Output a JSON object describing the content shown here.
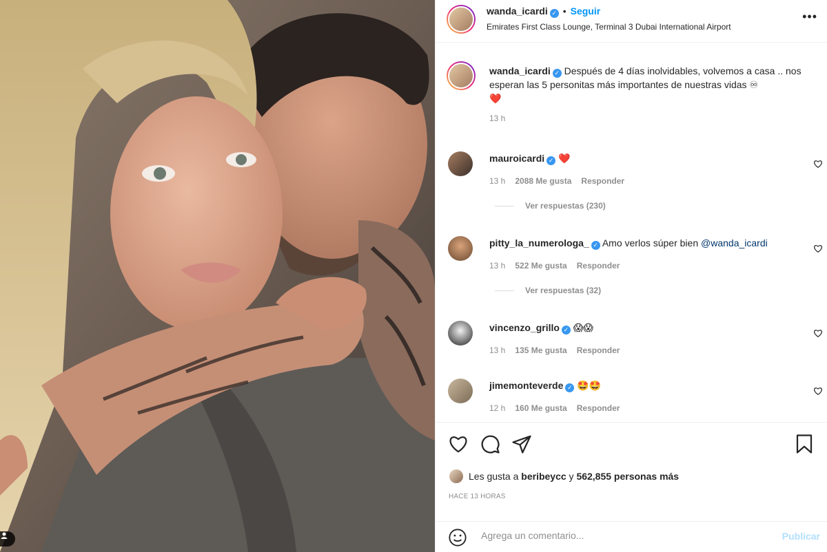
{
  "post": {
    "author": "wanda_icardi",
    "follow_label": "Seguir",
    "location": "Emirates First Class Lounge, Terminal 3 Dubai International Airport",
    "more_icon": "more-horizontal-icon",
    "caption": "Después de 4 días inolvidables, volvemos a casa .. nos esperan las 5 personitas más importantes de nuestras vidas ♾",
    "caption_emoji": "❤️",
    "caption_time": "13 h"
  },
  "comments": [
    {
      "user": "mauroicardi",
      "text": "",
      "emoji": "❤️",
      "time": "13 h",
      "likes": "2088 Me gusta",
      "reply": "Responder",
      "view_replies": "Ver respuestas (230)"
    },
    {
      "user": "pitty_la_numerologa_",
      "text": "Amo verlos súper bien",
      "mention": "@wanda_icardi",
      "time": "13 h",
      "likes": "522 Me gusta",
      "reply": "Responder",
      "view_replies": "Ver respuestas (32)"
    },
    {
      "user": "vincenzo_grillo",
      "text": "",
      "emoji": "😱😱",
      "time": "13 h",
      "likes": "135 Me gusta",
      "reply": "Responder"
    },
    {
      "user": "jimemonteverde",
      "text": "",
      "emoji": "🤩🤩",
      "time": "12 h",
      "likes": "160 Me gusta",
      "reply": "Responder"
    }
  ],
  "likes_summary": {
    "prefix": "Les gusta a",
    "user": "beribeycc",
    "conj": "y",
    "count": "562,855 personas más"
  },
  "time_ago": "HACE 13 HORAS",
  "add_comment": {
    "placeholder": "Agrega un comentario...",
    "publish_label": "Publicar"
  },
  "colors": {
    "accent": "#0095f6",
    "verified": "#3897f0",
    "heart": "#ed4956",
    "muted": "#8e8e8e"
  }
}
